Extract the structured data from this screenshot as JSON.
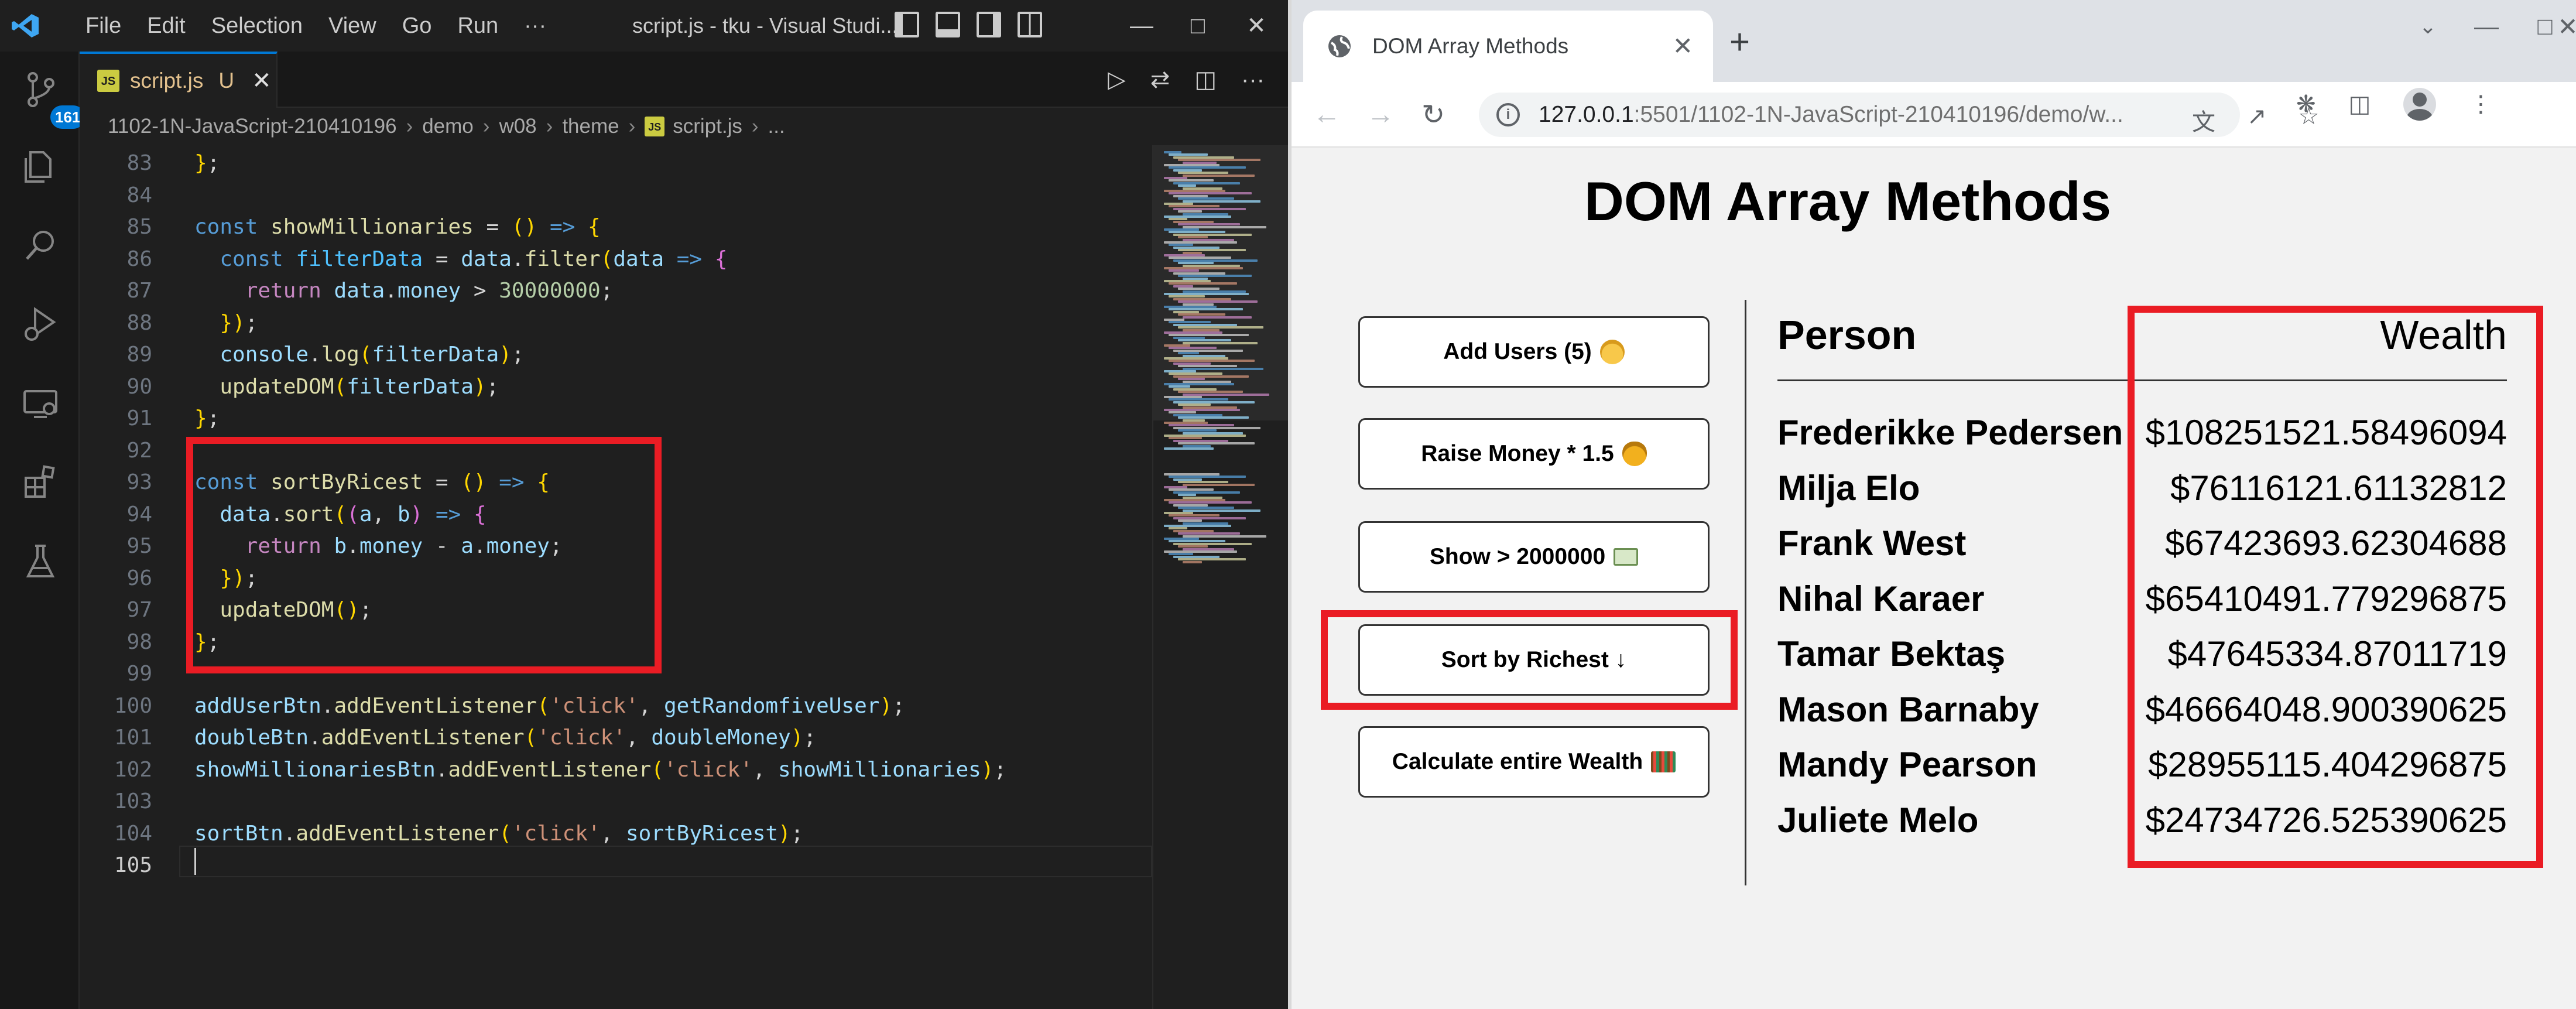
{
  "vscode": {
    "menu": [
      "File",
      "Edit",
      "Selection",
      "View",
      "Go",
      "Run",
      "···"
    ],
    "window_title": "script.js - tku - Visual Studi...",
    "scm_badge": "161",
    "tab": {
      "filename": "script.js",
      "status": "U",
      "icon_text": "JS"
    },
    "breadcrumb": [
      "1102-1N-JavaScript-210410196",
      "demo",
      "w08",
      "theme",
      "script.js",
      "..."
    ],
    "line_numbers": [
      "83",
      "84",
      "85",
      "86",
      "87",
      "88",
      "89",
      "90",
      "91",
      "92",
      "93",
      "94",
      "95",
      "96",
      "97",
      "98",
      "99",
      "100",
      "101",
      "102",
      "103",
      "104",
      "105"
    ],
    "current_line": "105",
    "code_lines": [
      "};",
      "",
      "const showMillionaries = () => {",
      "  const filterData = data.filter(data => {",
      "    return data.money > 30000000;",
      "  });",
      "  console.log(filterData);",
      "  updateDOM(filterData);",
      "};",
      "",
      "const sortByRicest = () => {",
      "  data.sort((a, b) => {",
      "    return b.money - a.money;",
      "  });",
      "  updateDOM();",
      "};",
      "",
      "addUserBtn.addEventListener('click', getRandomfiveUser);",
      "doubleBtn.addEventListener('click', doubleMoney);",
      "showMillionariesBtn.addEventListener('click', showMillionaries);",
      "",
      "sortBtn.addEventListener('click', sortByRicest);",
      ""
    ],
    "highlight_color": "#ea1c24"
  },
  "chrome": {
    "tab_title": "DOM Array Methods",
    "url_host": "127.0.0.1",
    "url_rest": ":5501/1102-1N-JavaScript-210410196/demo/w...",
    "page": {
      "title": "DOM Array Methods",
      "buttons": [
        {
          "label": "Add Users (5)",
          "icon": "person-emoji-icon"
        },
        {
          "label": "Raise Money * 1.5",
          "icon": "money-bag-emoji-icon"
        },
        {
          "label": "Show > 2000000",
          "icon": "banknote-emoji-icon"
        },
        {
          "label": "Sort by Richest ↓",
          "icon": ""
        },
        {
          "label": "Calculate entire Wealth",
          "icon": "abacus-emoji-icon"
        }
      ],
      "table": {
        "col_person": "Person",
        "col_wealth": "Wealth",
        "rows": [
          {
            "name": "Frederikke Pedersen",
            "wealth": "$108251521.58496094"
          },
          {
            "name": "Milja Elo",
            "wealth": "$76116121.61132812"
          },
          {
            "name": "Frank West",
            "wealth": "$67423693.62304688"
          },
          {
            "name": "Nihal Karaer",
            "wealth": "$65410491.779296875"
          },
          {
            "name": "Tamar Bektaş",
            "wealth": "$47645334.87011719"
          },
          {
            "name": "Mason Barnaby",
            "wealth": "$46664048.900390625"
          },
          {
            "name": "Mandy Pearson",
            "wealth": "$28955115.404296875"
          },
          {
            "name": "Juliete Melo",
            "wealth": "$24734726.525390625"
          }
        ]
      }
    }
  }
}
